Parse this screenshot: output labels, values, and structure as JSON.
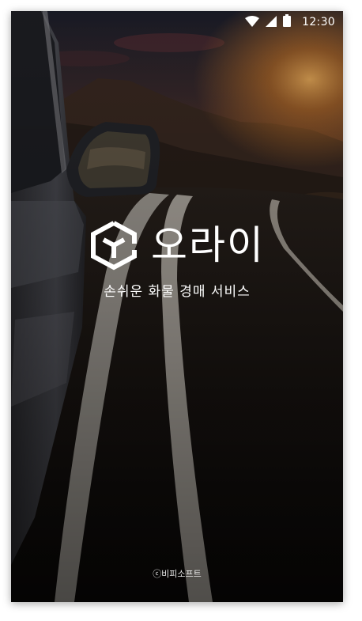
{
  "status_bar": {
    "time": "12:30",
    "icons": [
      "wifi-icon",
      "cellular-signal-icon",
      "battery-icon"
    ]
  },
  "splash": {
    "app_name": "오라이",
    "logo_icon": "cube-logo-icon",
    "tagline": "손쉬운 화물 경매 서비스",
    "copyright": "ⓒ비피소프트"
  },
  "colors": {
    "text": "#ffffff",
    "background_dark": "#0b0907",
    "sunset_glow": "#c9772a"
  }
}
